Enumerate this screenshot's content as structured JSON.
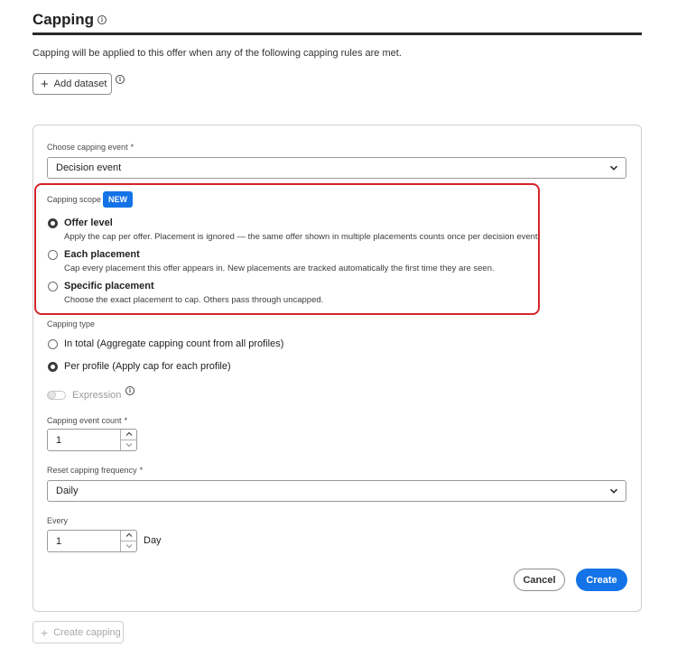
{
  "header": {
    "title": "Capping"
  },
  "intro_text": "Capping will be applied to this offer when any of the following capping rules are met.",
  "add_dataset_label": "Add dataset",
  "capping_event": {
    "label": "Choose capping event",
    "required_mark": "*",
    "value": "Decision event"
  },
  "capping_scope": {
    "label": "Capping scope",
    "badge": "NEW",
    "options": [
      {
        "label": "Offer level",
        "description": "Apply the cap per offer. Placement is ignored — the same offer shown in multiple placements counts once per decision event.",
        "selected": true
      },
      {
        "label": "Each placement",
        "description": "Cap every placement this offer appears in. New placements are tracked automatically the first time they are seen.",
        "selected": false
      },
      {
        "label": "Specific placement",
        "description": "Choose the exact placement to cap. Others pass through uncapped.",
        "selected": false
      }
    ]
  },
  "capping_type": {
    "label": "Capping type",
    "options": [
      {
        "label": "In total (Aggregate capping count from all profiles)",
        "selected": false
      },
      {
        "label": "Per profile (Apply cap for each profile)",
        "selected": true
      }
    ]
  },
  "expression": {
    "label": "Expression",
    "enabled": false
  },
  "event_count": {
    "label": "Capping event count",
    "required_mark": "*",
    "value": "1"
  },
  "reset_frequency": {
    "label": "Reset capping frequency",
    "required_mark": "*",
    "value": "Daily"
  },
  "every": {
    "label": "Every",
    "value": "1",
    "unit": "Day"
  },
  "actions": {
    "cancel": "Cancel",
    "create": "Create"
  },
  "create_capping_label": "Create capping",
  "colors": {
    "accent": "#1473e6",
    "highlight_border": "#d6232b"
  }
}
